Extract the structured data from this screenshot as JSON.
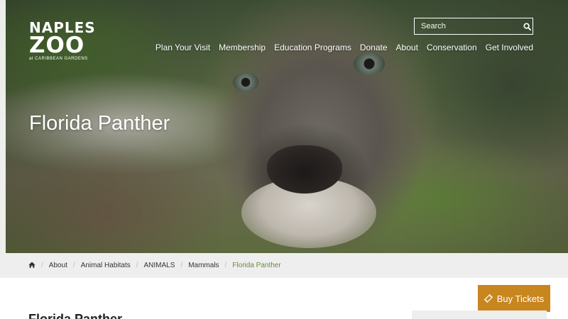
{
  "logo": {
    "line1": "NAPLES",
    "line2": "ZOO",
    "line3": "at CARIBBEAN GARDENS"
  },
  "search": {
    "placeholder": "Search",
    "icon": "search-icon"
  },
  "nav": [
    {
      "label": "Plan Your Visit"
    },
    {
      "label": "Membership"
    },
    {
      "label": "Education Programs"
    },
    {
      "label": "Donate"
    },
    {
      "label": "About"
    },
    {
      "label": "Conservation"
    },
    {
      "label": "Get Involved"
    }
  ],
  "hero": {
    "title": "Florida Panther"
  },
  "breadcrumb": {
    "home_icon": "home-icon",
    "items": [
      "About",
      "Animal Habitats",
      "ANIMALS",
      "Mammals"
    ],
    "current": "Florida Panther"
  },
  "buy_tickets": {
    "label": "Buy Tickets",
    "icon": "ticket-icon",
    "color": "#c8861f"
  },
  "content": {
    "title": "Florida Panther"
  },
  "colors": {
    "accent_green": "#6a8a3a",
    "breadcrumb_bg": "#eeeeee"
  }
}
